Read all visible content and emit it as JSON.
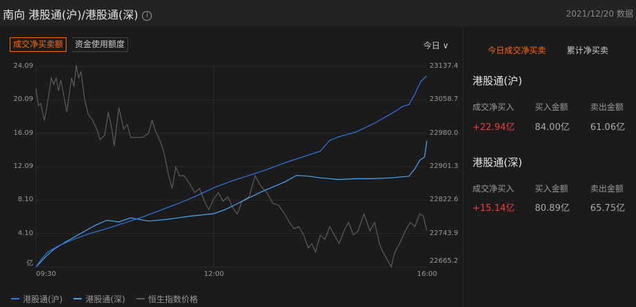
{
  "header": {
    "title": "南向 港股通(沪)/港股通(深)",
    "info_icon": "i",
    "date": "2021/12/20 数据"
  },
  "tabs": [
    {
      "label": "成交净买卖额",
      "active": true
    },
    {
      "label": "资金使用额度",
      "active": false
    }
  ],
  "period_select": "今日 ∨",
  "right_tabs": [
    {
      "label": "今日成交净买卖",
      "active": true
    },
    {
      "label": "累计净买卖",
      "active": false
    }
  ],
  "colors": {
    "accent": "#ff6a00",
    "sh": "#2f78e8",
    "sz": "#4aa6f0",
    "hsi": "#5c5c5c",
    "up": "#f23d3d"
  },
  "sections": [
    {
      "title": "港股通(沪)",
      "labels": [
        "成交净买入",
        "买入金额",
        "卖出金额"
      ],
      "values": [
        "+22.94亿",
        "84.00亿",
        "61.06亿"
      ]
    },
    {
      "title": "港股通(深)",
      "labels": [
        "成交净买入",
        "买入金额",
        "卖出金额"
      ],
      "values": [
        "+15.14亿",
        "80.89亿",
        "65.75亿"
      ]
    }
  ],
  "chart_data": {
    "type": "line",
    "x_unit": "trading minutes from 09:30 (lunch break removed)",
    "x_range": [
      0,
      330
    ],
    "x_ticks": [
      {
        "m": 0,
        "label": "09:30"
      },
      {
        "m": 150,
        "label": "12:00"
      },
      {
        "m": 330,
        "label": "16:00"
      }
    ],
    "y_left": {
      "unit": "亿",
      "range": [
        0,
        24.09
      ],
      "ticks": [
        "亿",
        "4.10",
        "8.10",
        "12.09",
        "16.09",
        "20.09",
        "24.09"
      ]
    },
    "y_right": {
      "range": [
        22665.2,
        23137.4
      ],
      "ticks": [
        "22665.2",
        "22743.9",
        "22822.6",
        "22901.3",
        "22980.0",
        "23058.7",
        "23137.4"
      ]
    },
    "grid": true,
    "legend_position": "bottom-left",
    "series": [
      {
        "name": "港股通(沪)",
        "axis": "left",
        "points": [
          [
            0,
            0
          ],
          [
            5,
            1
          ],
          [
            10,
            1.8
          ],
          [
            20,
            2.6
          ],
          [
            30,
            3.2
          ],
          [
            45,
            4
          ],
          [
            60,
            4.6
          ],
          [
            75,
            5.3
          ],
          [
            90,
            6
          ],
          [
            105,
            6.8
          ],
          [
            120,
            7.6
          ],
          [
            135,
            8.5
          ],
          [
            150,
            9.5
          ],
          [
            165,
            10.3
          ],
          [
            180,
            11
          ],
          [
            195,
            11.7
          ],
          [
            210,
            12.5
          ],
          [
            225,
            13.2
          ],
          [
            240,
            13.9
          ],
          [
            248,
            15.2
          ],
          [
            255,
            15.6
          ],
          [
            270,
            16.2
          ],
          [
            285,
            17.2
          ],
          [
            300,
            18.4
          ],
          [
            310,
            19.3
          ],
          [
            315,
            19.5
          ],
          [
            320,
            20.8
          ],
          [
            325,
            22.3
          ],
          [
            330,
            22.94
          ]
        ]
      },
      {
        "name": "港股通(深)",
        "axis": "left",
        "points": [
          [
            0,
            0
          ],
          [
            8,
            1.2
          ],
          [
            15,
            2.1
          ],
          [
            25,
            3
          ],
          [
            35,
            3.8
          ],
          [
            50,
            5
          ],
          [
            60,
            5.6
          ],
          [
            70,
            5.4
          ],
          [
            80,
            5.9
          ],
          [
            95,
            5.5
          ],
          [
            110,
            5.7
          ],
          [
            130,
            6.1
          ],
          [
            150,
            6.4
          ],
          [
            160,
            6.9
          ],
          [
            170,
            7.6
          ],
          [
            180,
            8.3
          ],
          [
            190,
            9
          ],
          [
            200,
            9.6
          ],
          [
            210,
            10.2
          ],
          [
            220,
            11
          ],
          [
            230,
            10.9
          ],
          [
            240,
            10.7
          ],
          [
            255,
            10.5
          ],
          [
            270,
            10.6
          ],
          [
            285,
            10.6
          ],
          [
            300,
            10.7
          ],
          [
            315,
            10.9
          ],
          [
            320,
            11.8
          ],
          [
            324,
            12.8
          ],
          [
            328,
            13.2
          ],
          [
            329,
            14
          ],
          [
            330,
            15.14
          ]
        ]
      },
      {
        "name": "恒生指数价格",
        "axis": "right",
        "points": [
          [
            0,
            23085
          ],
          [
            2,
            23045
          ],
          [
            4,
            23050
          ],
          [
            7,
            23010
          ],
          [
            9,
            23040
          ],
          [
            13,
            23110
          ],
          [
            15,
            23095
          ],
          [
            17,
            23110
          ],
          [
            19,
            23080
          ],
          [
            21,
            23105
          ],
          [
            26,
            23030
          ],
          [
            30,
            23110
          ],
          [
            32,
            23090
          ],
          [
            34,
            23140
          ],
          [
            36,
            23110
          ],
          [
            38,
            23125
          ],
          [
            41,
            23060
          ],
          [
            44,
            23025
          ],
          [
            48,
            23010
          ],
          [
            52,
            22985
          ],
          [
            54,
            22965
          ],
          [
            58,
            22975
          ],
          [
            61,
            23030
          ],
          [
            64,
            22990
          ],
          [
            66,
            22950
          ],
          [
            70,
            23040
          ],
          [
            74,
            22990
          ],
          [
            77,
            23000
          ],
          [
            80,
            22970
          ],
          [
            84,
            22970
          ],
          [
            90,
            22970
          ],
          [
            95,
            22980
          ],
          [
            98,
            23010
          ],
          [
            101,
            22985
          ],
          [
            105,
            22960
          ],
          [
            108,
            22935
          ],
          [
            112,
            22880
          ],
          [
            115,
            22850
          ],
          [
            118,
            22900
          ],
          [
            121,
            22880
          ],
          [
            125,
            22880
          ],
          [
            130,
            22860
          ],
          [
            134,
            22840
          ],
          [
            138,
            22850
          ],
          [
            143,
            22815
          ],
          [
            146,
            22800
          ],
          [
            150,
            22825
          ],
          [
            154,
            22840
          ],
          [
            158,
            22820
          ],
          [
            162,
            22830
          ],
          [
            166,
            22805
          ],
          [
            170,
            22790
          ],
          [
            174,
            22820
          ],
          [
            180,
            22830
          ],
          [
            185,
            22880
          ],
          [
            190,
            22855
          ],
          [
            195,
            22840
          ],
          [
            200,
            22815
          ],
          [
            205,
            22810
          ],
          [
            210,
            22790
          ],
          [
            214,
            22770
          ],
          [
            218,
            22755
          ],
          [
            222,
            22760
          ],
          [
            226,
            22740
          ],
          [
            230,
            22710
          ],
          [
            233,
            22720
          ],
          [
            236,
            22700
          ],
          [
            240,
            22740
          ],
          [
            244,
            22730
          ],
          [
            248,
            22760
          ],
          [
            252,
            22740
          ],
          [
            256,
            22720
          ],
          [
            260,
            22750
          ],
          [
            264,
            22770
          ],
          [
            268,
            22740
          ],
          [
            272,
            22750
          ],
          [
            277,
            22790
          ],
          [
            282,
            22750
          ],
          [
            286,
            22770
          ],
          [
            290,
            22720
          ],
          [
            293,
            22700
          ],
          [
            297,
            22680
          ],
          [
            300,
            22665
          ],
          [
            303,
            22700
          ],
          [
            307,
            22720
          ],
          [
            312,
            22750
          ],
          [
            316,
            22770
          ],
          [
            320,
            22760
          ],
          [
            324,
            22790
          ],
          [
            327,
            22785
          ],
          [
            330,
            22750
          ]
        ]
      }
    ]
  },
  "legend": [
    "港股通(沪)",
    "港股通(深)",
    "恒生指数价格"
  ]
}
